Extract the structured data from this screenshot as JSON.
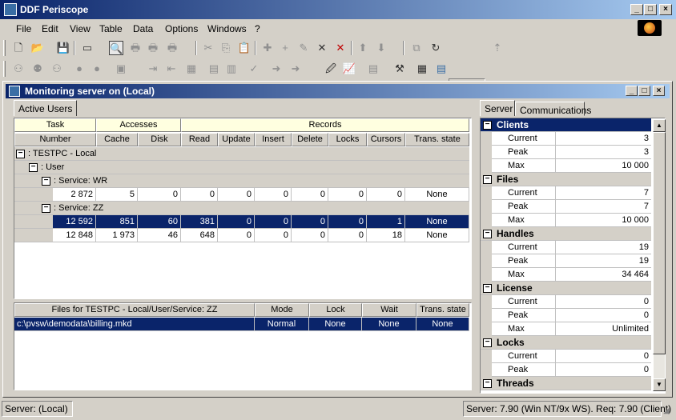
{
  "app": {
    "title": "DDF Periscope"
  },
  "menu": [
    "File",
    "Edit",
    "View",
    "Table",
    "Data",
    "Options",
    "Windows",
    "?"
  ],
  "child": {
    "title": "Monitoring server on (Local)"
  },
  "left_tabs": [
    "Active Users"
  ],
  "users_grid": {
    "group_headers": {
      "task": "Task",
      "accesses": "Accesses",
      "records": "Records"
    },
    "columns": [
      "Number",
      "Cache",
      "Disk",
      "Read",
      "Update",
      "Insert",
      "Delete",
      "Locks",
      "Cursors",
      "Trans. state"
    ],
    "tree": {
      "root": ": TESTPC - Local",
      "user": ": User",
      "svc_wr": ": Service: WR",
      "svc_zz": ": Service: ZZ"
    },
    "rows": [
      {
        "number": "2 872",
        "cache": "5",
        "disk": "0",
        "read": "0",
        "update": "0",
        "insert": "0",
        "delete": "0",
        "locks": "0",
        "cursors": "0",
        "trans": "None"
      },
      {
        "number": "12 592",
        "cache": "851",
        "disk": "60",
        "read": "381",
        "update": "0",
        "insert": "0",
        "delete": "0",
        "locks": "0",
        "cursors": "1",
        "trans": "None"
      },
      {
        "number": "12 848",
        "cache": "1 973",
        "disk": "46",
        "read": "648",
        "update": "0",
        "insert": "0",
        "delete": "0",
        "locks": "0",
        "cursors": "18",
        "trans": "None"
      }
    ]
  },
  "files_grid": {
    "columns": [
      "Files for TESTPC - Local/User/Service: ZZ",
      "Mode",
      "Lock",
      "Wait",
      "Trans. state"
    ],
    "rows": [
      {
        "file": "c:\\pvsw\\demodata\\billing.mkd",
        "mode": "Normal",
        "lock": "None",
        "wait": "None",
        "trans": "None"
      }
    ]
  },
  "right_tabs": [
    "Server",
    "Communications"
  ],
  "server_props": [
    {
      "name": "Clients",
      "items": [
        {
          "label": "Current",
          "value": "3"
        },
        {
          "label": "Peak",
          "value": "3"
        },
        {
          "label": "Max",
          "value": "10 000"
        }
      ]
    },
    {
      "name": "Files",
      "items": [
        {
          "label": "Current",
          "value": "7"
        },
        {
          "label": "Peak",
          "value": "7"
        },
        {
          "label": "Max",
          "value": "10 000"
        }
      ]
    },
    {
      "name": "Handles",
      "items": [
        {
          "label": "Current",
          "value": "19"
        },
        {
          "label": "Peak",
          "value": "19"
        },
        {
          "label": "Max",
          "value": "34 464"
        }
      ]
    },
    {
      "name": "License",
      "items": [
        {
          "label": "Current",
          "value": "0"
        },
        {
          "label": "Peak",
          "value": "0"
        },
        {
          "label": "Max",
          "value": "Unlimited"
        }
      ]
    },
    {
      "name": "Locks",
      "items": [
        {
          "label": "Current",
          "value": "0"
        },
        {
          "label": "Peak",
          "value": "0"
        }
      ]
    },
    {
      "name": "Threads",
      "items": []
    }
  ],
  "status": {
    "left": "Server: (Local)",
    "right": "Server: 7.90 (Win NT/9x WS). Req: 7.90 (Client)"
  }
}
